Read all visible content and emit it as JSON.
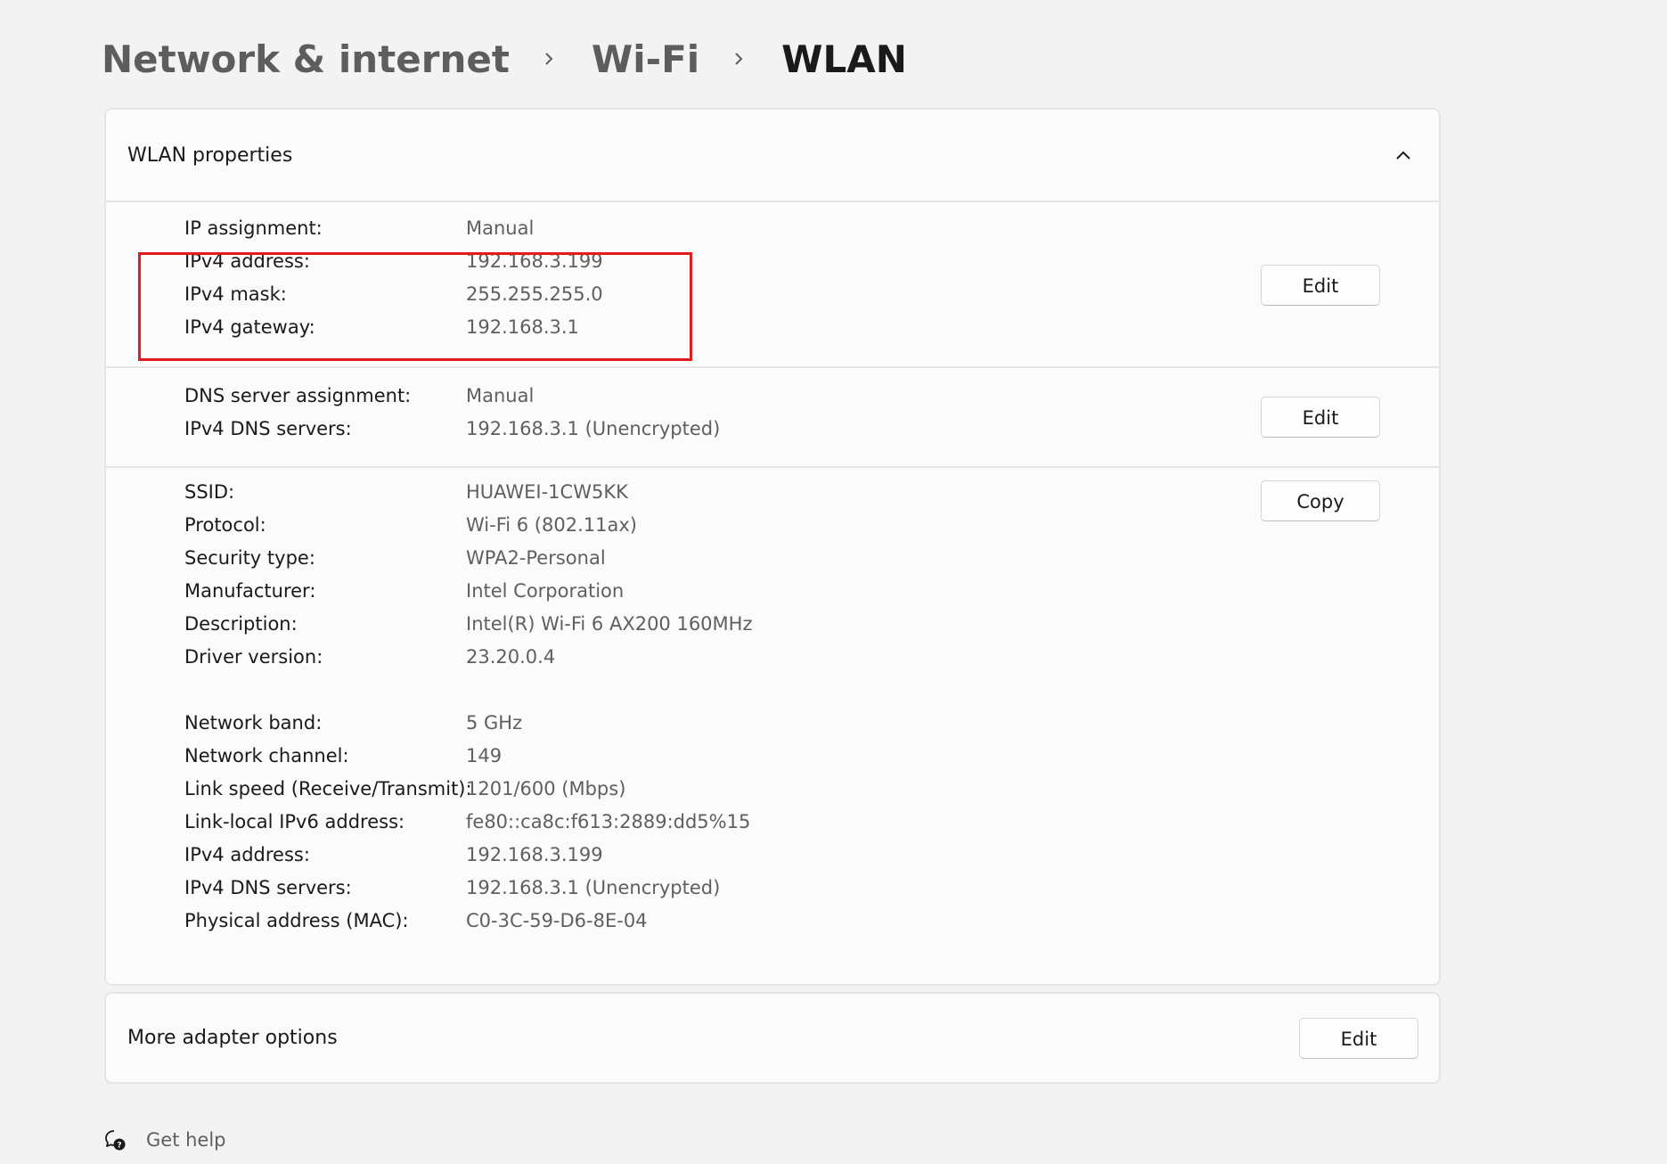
{
  "breadcrumb": {
    "items": [
      "Network & internet",
      "Wi-Fi"
    ],
    "current": "WLAN"
  },
  "properties": {
    "title": "WLAN properties",
    "ip_section": {
      "rows": [
        {
          "label": "IP assignment:",
          "value": "Manual"
        },
        {
          "label": "IPv4 address:",
          "value": "192.168.3.199"
        },
        {
          "label": "IPv4 mask:",
          "value": "255.255.255.0"
        },
        {
          "label": "IPv4 gateway:",
          "value": "192.168.3.1"
        }
      ],
      "edit_label": "Edit"
    },
    "dns_section": {
      "rows": [
        {
          "label": "DNS server assignment:",
          "value": "Manual"
        },
        {
          "label": "IPv4 DNS servers:",
          "value": "192.168.3.1 (Unencrypted)"
        }
      ],
      "edit_label": "Edit"
    },
    "info_section": {
      "copy_label": "Copy",
      "rows": [
        {
          "label": "SSID:",
          "value": "HUAWEI-1CW5KK"
        },
        {
          "label": "Protocol:",
          "value": "Wi-Fi 6 (802.11ax)"
        },
        {
          "label": "Security type:",
          "value": "WPA2-Personal"
        },
        {
          "label": "Manufacturer:",
          "value": "Intel Corporation"
        },
        {
          "label": "Description:",
          "value": "Intel(R) Wi-Fi 6 AX200 160MHz"
        },
        {
          "label": "Driver version:",
          "value": "23.20.0.4"
        },
        {
          "label": "Network band:",
          "value": "5 GHz"
        },
        {
          "label": "Network channel:",
          "value": "149"
        },
        {
          "label": "Link speed (Receive/Transmit):",
          "value": "1201/600 (Mbps)"
        },
        {
          "label": "Link-local IPv6 address:",
          "value": "fe80::ca8c:f613:2889:dd5%15"
        },
        {
          "label": "IPv4 address:",
          "value": "192.168.3.199"
        },
        {
          "label": "IPv4 DNS servers:",
          "value": "192.168.3.1 (Unencrypted)"
        },
        {
          "label": "Physical address (MAC):",
          "value": "C0-3C-59-D6-8E-04"
        }
      ]
    }
  },
  "adapter": {
    "label": "More adapter options",
    "edit_label": "Edit"
  },
  "help": {
    "label": "Get help"
  },
  "colors": {
    "highlight": "#e8191c",
    "background": "#f3f3f3",
    "card": "#fbfbfb"
  },
  "icons": {
    "breadcrumb_separator": "chevron-right-icon",
    "collapse": "chevron-up-icon",
    "help": "help-chat-icon"
  }
}
